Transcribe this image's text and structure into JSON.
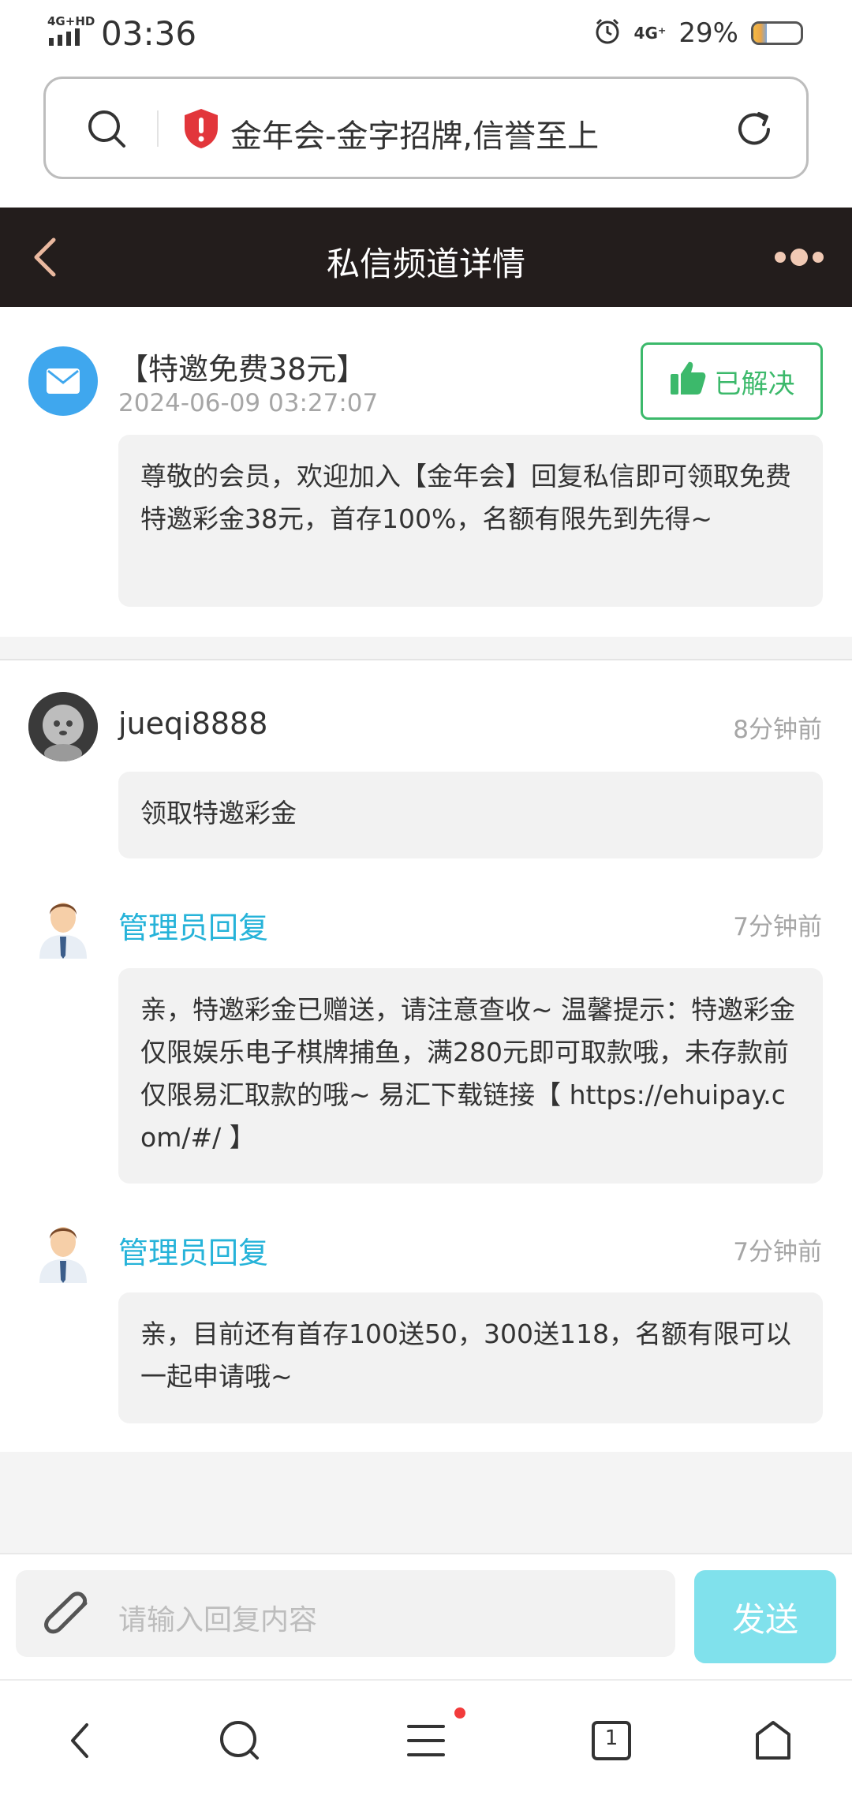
{
  "status_bar": {
    "network": "4G+HD",
    "time": "03:36",
    "network_right": "4G⁺",
    "battery_percent": "29%",
    "battery_level": 0.29
  },
  "url_bar": {
    "title": "金年会-金字招牌,信誉至上"
  },
  "header": {
    "title": "私信频道详情"
  },
  "main_message": {
    "title": "【特邀免费38元】",
    "date": "2024-06-09 03:27:07",
    "solved_label": "已解决",
    "body": "尊敬的会员，欢迎加入【金年会】回复私信即可领取免费特邀彩金38元，首存100%，名额有限先到先得~"
  },
  "replies": [
    {
      "name": "jueqi8888",
      "time": "8分钟前",
      "body": "领取特邀彩金",
      "kind": "user"
    },
    {
      "name": "管理员回复",
      "time": "7分钟前",
      "body": "亲，特邀彩金已赠送，请注意查收~ 温馨提示：特邀彩金仅限娱乐电子棋牌捕鱼，满280元即可取款哦，未存款前仅限易汇取款的哦~ 易汇下载链接【 https://ehuipay.com/#/ 】",
      "kind": "admin"
    },
    {
      "name": "管理员回复",
      "time": "7分钟前",
      "body": "亲，目前还有首存100送50，300送118，名额有限可以一起申请哦~",
      "kind": "admin"
    }
  ],
  "input": {
    "placeholder": "请输入回复内容",
    "send_label": "发送"
  },
  "bottom_nav": {
    "tab_count": "1"
  },
  "colors": {
    "header_bg": "#231d1c",
    "admin_name": "#26b3d9",
    "solved_green": "#3cb96b",
    "send_button": "#80e1ec",
    "mail_avatar": "#3fa7ee"
  }
}
